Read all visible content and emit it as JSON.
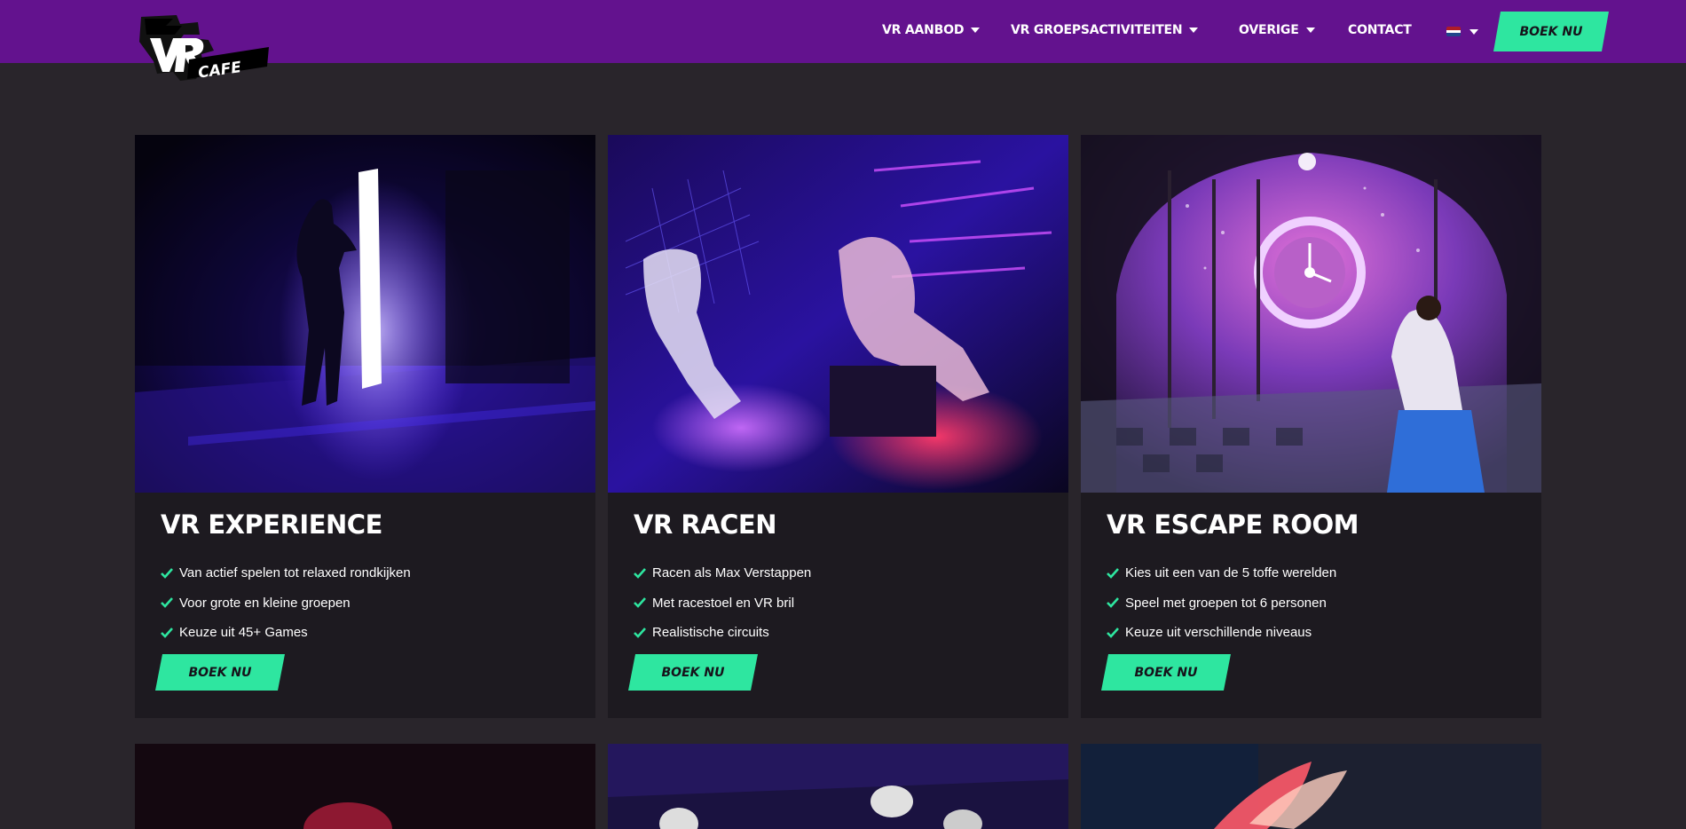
{
  "header": {
    "logo_text": "VR CAFE",
    "nav": [
      {
        "label": "VR AANBOD",
        "has_dropdown": true
      },
      {
        "label": "VR GROEPSACTIVITEITEN",
        "has_dropdown": true
      },
      {
        "label": "OVERIGE",
        "has_dropdown": true
      },
      {
        "label": "CONTACT",
        "has_dropdown": false
      }
    ],
    "language_flag": "netherlands-flag-icon",
    "cta_label": "BOEK NU"
  },
  "colors": {
    "header_bg": "#63128e",
    "page_bg": "#29252b",
    "card_bg": "#1d1a20",
    "accent": "#2ee6a0"
  },
  "cards": [
    {
      "title": "VR EXPERIENCE",
      "image": "vr-experience-photo",
      "features": [
        "Van actief spelen tot relaxed rondkijken",
        "Voor grote en kleine groepen",
        "Keuze uit 45+ Games"
      ],
      "cta_label": "BOEK NU"
    },
    {
      "title": "VR RACEN",
      "image": "vr-racen-photo",
      "features": [
        "Racen als Max Verstappen",
        "Met racestoel en VR bril",
        "Realistische circuits"
      ],
      "cta_label": "BOEK NU"
    },
    {
      "title": "VR ESCAPE ROOM",
      "image": "vr-escape-room-photo",
      "features": [
        "Kies uit een van de 5 toffe werelden",
        "Speel met groepen tot 6 personen",
        "Keuze uit verschillende niveaus"
      ],
      "cta_label": "BOEK NU"
    }
  ]
}
